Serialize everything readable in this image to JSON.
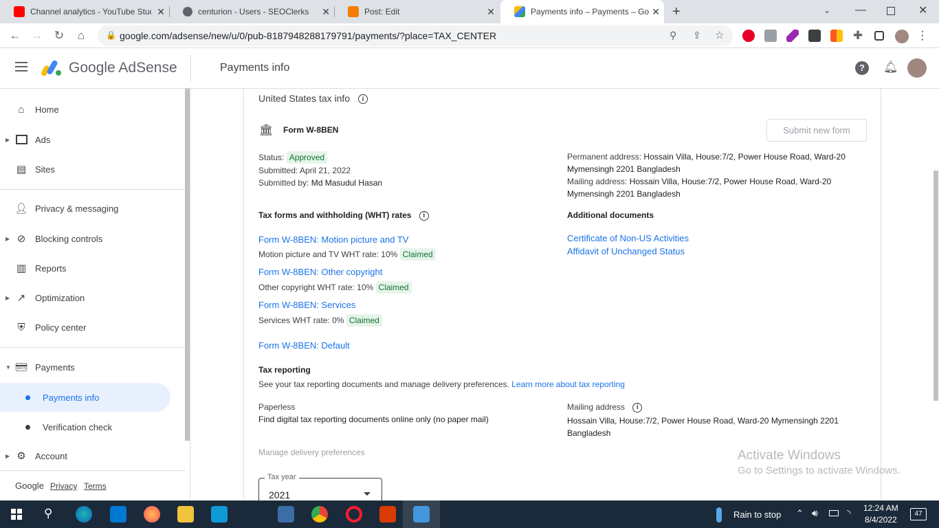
{
  "browser": {
    "tabs": [
      {
        "title": "Channel analytics - YouTube Studio",
        "icon": "youtube-icon",
        "color": "#ff0000"
      },
      {
        "title": "centurion - Users - SEOClerks",
        "icon": "seoclerks-icon",
        "color": "#5f6368"
      },
      {
        "title": "Post: Edit",
        "icon": "blogger-icon",
        "color": "#f57c00"
      },
      {
        "title": "Payments info – Payments – Goo",
        "icon": "adsense-icon",
        "color": "#fbbc04",
        "active": true
      }
    ],
    "new_tab": "+",
    "url": "google.com/adsense/new/u/0/pub-8187948288179791/payments/?place=TAX_CENTER"
  },
  "header": {
    "brand": "Google AdSense",
    "page_title": "Payments info"
  },
  "sidebar": {
    "items": [
      {
        "label": "Home",
        "icon": "home-icon"
      },
      {
        "label": "Ads",
        "icon": "ads-icon"
      },
      {
        "label": "Sites",
        "icon": "sites-icon"
      },
      {
        "label": "Privacy & messaging",
        "icon": "privacy-icon"
      },
      {
        "label": "Blocking controls",
        "icon": "blocking-icon"
      },
      {
        "label": "Reports",
        "icon": "reports-icon"
      },
      {
        "label": "Optimization",
        "icon": "optimization-icon"
      },
      {
        "label": "Policy center",
        "icon": "policy-icon"
      },
      {
        "label": "Payments",
        "icon": "payments-icon"
      },
      {
        "label": "Account",
        "icon": "account-icon"
      }
    ],
    "sub_items": [
      {
        "label": "Payments info",
        "active": true
      },
      {
        "label": "Verification check"
      }
    ],
    "footer": {
      "brand": "Google",
      "privacy": "Privacy",
      "terms": "Terms"
    }
  },
  "content": {
    "section_title": "United States tax info",
    "form_name": "Form W-8BEN",
    "submit_button": "Submit new form",
    "status_label": "Status:",
    "status_value": "Approved",
    "submitted": "Submitted: April 21, 2022",
    "submitted_by_label": "Submitted by:",
    "submitted_by": "Md Masudul Hasan",
    "permanent_address_label": "Permanent address:",
    "permanent_address_1": "Hossain Villa, House:7/2, Power House Road, Ward-20",
    "permanent_address_2": "Mymensingh 2201 Bangladesh",
    "mailing_address_label": "Mailing address:",
    "mailing_address_1": "Hossain Villa, House:7/2, Power House Road, Ward-20",
    "mailing_address_2": "Mymensingh 2201 Bangladesh",
    "wht_title": "Tax forms and withholding (WHT) rates",
    "wht_rows": [
      {
        "link": "Form W-8BEN: Motion picture and TV",
        "rate": "Motion picture and TV WHT rate: 10%",
        "badge": "Claimed"
      },
      {
        "link": "Form W-8BEN: Other copyright",
        "rate": "Other copyright WHT rate: 10%",
        "badge": "Claimed"
      },
      {
        "link": "Form W-8BEN: Services",
        "rate": "Services WHT rate: 0%",
        "badge": "Claimed"
      }
    ],
    "default_link": "Form W-8BEN: Default",
    "additional_title": "Additional documents",
    "additional_links": [
      "Certificate of Non-US Activities",
      "Affidavit of Unchanged Status"
    ],
    "reporting_title": "Tax reporting",
    "reporting_desc": "See your tax reporting documents and manage delivery preferences.",
    "reporting_link": "Learn more about tax reporting",
    "paperless_label": "Paperless",
    "paperless_desc": "Find digital tax reporting documents online only (no paper mail)",
    "reporting_mail_label": "Mailing address",
    "reporting_mail_1": "Hossain Villa, House:7/2, Power House Road, Ward-20 Mymensingh 2201",
    "reporting_mail_2": "Bangladesh",
    "manage_link": "Manage delivery preferences",
    "tax_year_label": "Tax year",
    "tax_year_value": "2021"
  },
  "watermark": {
    "line1": "Activate Windows",
    "line2": "Go to Settings to activate Windows."
  },
  "taskbar": {
    "weather": "Rain to stop",
    "time": "12:24 AM",
    "date": "8/4/2022",
    "notifications": "47"
  }
}
